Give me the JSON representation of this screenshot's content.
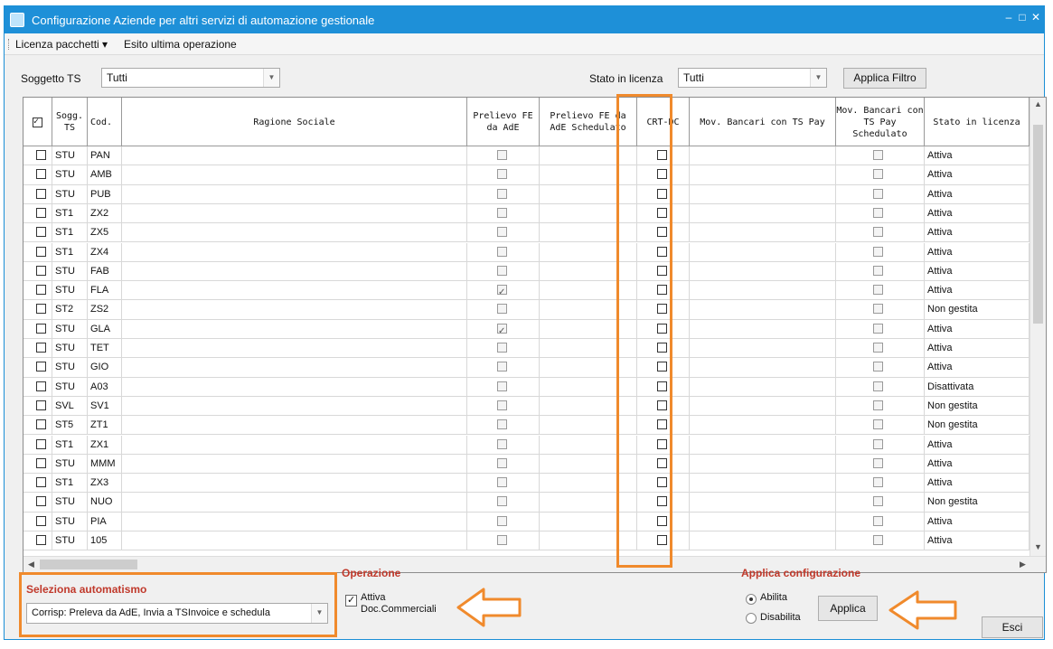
{
  "window": {
    "title": "Configurazione Aziende per altri servizi di automazione gestionale",
    "controls": [
      "–",
      "□",
      "✕"
    ]
  },
  "menu": {
    "licenza_pacchetti": "Licenza pacchetti ▾",
    "esito": "Esito ultima operazione"
  },
  "filters": {
    "soggetto_label": "Soggetto TS",
    "soggetto_value": "Tutti",
    "stato_label": "Stato in licenza",
    "stato_value": "Tutti",
    "apply_label": "Applica Filtro"
  },
  "grid": {
    "headers": {
      "sogg": "Sogg. TS",
      "cod": "Cod.",
      "ragione": "Ragione Sociale",
      "prelievo": "Prelievo FE da AdE",
      "prelievo_sched": "Prelievo FE da AdE Schedulato",
      "crt": "CRT-DC",
      "mov": "Mov. Bancari con TS Pay",
      "mov_sched": "Mov. Bancari con TS Pay Schedulato",
      "stato": "Stato in licenza"
    },
    "rows": [
      {
        "sogg": "STU",
        "cod": "PAN",
        "prelievo": false,
        "stato": "Attiva"
      },
      {
        "sogg": "STU",
        "cod": "AMB",
        "prelievo": false,
        "stato": "Attiva"
      },
      {
        "sogg": "STU",
        "cod": "PUB",
        "prelievo": false,
        "stato": "Attiva"
      },
      {
        "sogg": "ST1",
        "cod": "ZX2",
        "prelievo": false,
        "stato": "Attiva"
      },
      {
        "sogg": "ST1",
        "cod": "ZX5",
        "prelievo": false,
        "stato": "Attiva"
      },
      {
        "sogg": "ST1",
        "cod": "ZX4",
        "prelievo": false,
        "stato": "Attiva"
      },
      {
        "sogg": "STU",
        "cod": "FAB",
        "prelievo": false,
        "stato": "Attiva"
      },
      {
        "sogg": "STU",
        "cod": "FLA",
        "prelievo": true,
        "stato": "Attiva"
      },
      {
        "sogg": "ST2",
        "cod": "ZS2",
        "prelievo": false,
        "stato": "Non gestita"
      },
      {
        "sogg": "STU",
        "cod": "GLA",
        "prelievo": true,
        "stato": "Attiva"
      },
      {
        "sogg": "STU",
        "cod": "TET",
        "prelievo": false,
        "stato": "Attiva"
      },
      {
        "sogg": "STU",
        "cod": "GIO",
        "prelievo": false,
        "stato": "Attiva"
      },
      {
        "sogg": "STU",
        "cod": "A03",
        "prelievo": false,
        "stato": "Disattivata"
      },
      {
        "sogg": "SVL",
        "cod": "SV1",
        "prelievo": false,
        "stato": "Non gestita"
      },
      {
        "sogg": "ST5",
        "cod": "ZT1",
        "prelievo": false,
        "stato": "Non gestita"
      },
      {
        "sogg": "ST1",
        "cod": "ZX1",
        "prelievo": false,
        "stato": "Attiva"
      },
      {
        "sogg": "STU",
        "cod": "MMM",
        "prelievo": false,
        "stato": "Attiva"
      },
      {
        "sogg": "ST1",
        "cod": "ZX3",
        "prelievo": false,
        "stato": "Attiva"
      },
      {
        "sogg": "STU",
        "cod": "NUO",
        "prelievo": false,
        "stato": "Non gestita"
      },
      {
        "sogg": "STU",
        "cod": "PIA",
        "prelievo": false,
        "stato": "Attiva"
      },
      {
        "sogg": "STU",
        "cod": "105",
        "prelievo": false,
        "stato": "Attiva"
      }
    ]
  },
  "bottom": {
    "automatismo_title": "Seleziona automatismo",
    "automatismo_value": "Corrisp: Preleva da AdE, Invia a TSInvoice e schedula",
    "operazione_title": "Operazione",
    "attiva_label": "Attiva Doc.Commerciali",
    "applica_conf_title": "Applica configurazione",
    "abilita": "Abilita",
    "disabilita": "Disabilita",
    "applica_button": "Applica",
    "esci_button": "Esci"
  },
  "colors": {
    "titlebar": "#1e90d8",
    "highlight": "#f08a2c",
    "section_title": "#c0392b"
  }
}
